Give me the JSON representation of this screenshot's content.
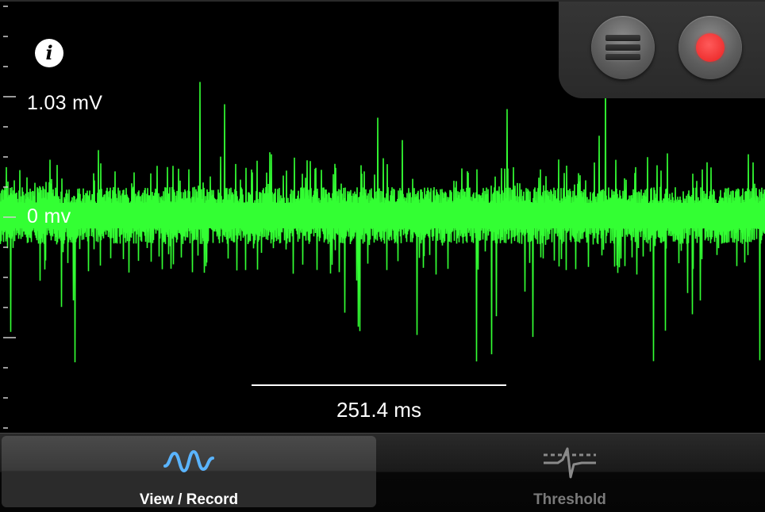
{
  "colors": {
    "waveform": "#33ff33",
    "background": "#000000",
    "record": "#ff3b3b",
    "active_tab_icon": "#5ab4ff"
  },
  "scope": {
    "top_label": "1.03 mV",
    "zero_label": "0 mv",
    "time_scale_label": "251.4 ms"
  },
  "controls": {
    "info_icon": "info-icon",
    "menu_icon": "menu-icon",
    "record_icon": "record-icon"
  },
  "tabbar": {
    "tabs": [
      {
        "label": "View / Record",
        "icon": "waveform-icon",
        "active": true
      },
      {
        "label": "Threshold",
        "icon": "spike-threshold-icon",
        "active": false
      }
    ]
  }
}
